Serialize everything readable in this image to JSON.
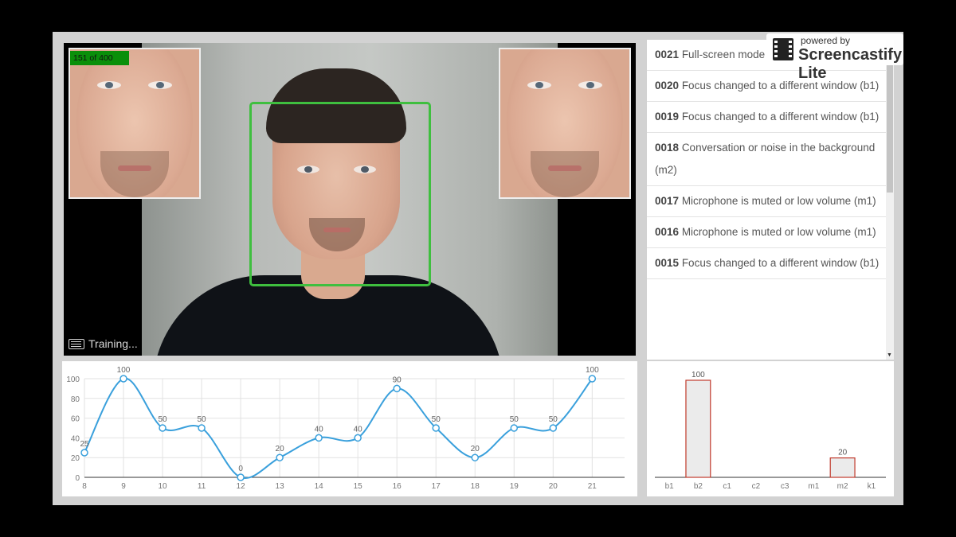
{
  "video": {
    "frame_counter": "151 of 400",
    "status": "Training..."
  },
  "watermark": {
    "line1": "powered by",
    "line2": "Screencastify Lite"
  },
  "event_log": [
    {
      "id": "0021",
      "text": "Full-screen mode"
    },
    {
      "id": "0020",
      "text": "Focus changed to a different window (b1)"
    },
    {
      "id": "0019",
      "text": "Focus changed to a different window (b1)"
    },
    {
      "id": "0018",
      "text": "Conversation or noise in the background (m2)"
    },
    {
      "id": "0017",
      "text": "Microphone is muted or low volume (m1)"
    },
    {
      "id": "0016",
      "text": "Microphone is muted or low volume (m1)"
    },
    {
      "id": "0015",
      "text": "Focus changed to a different window (b1)"
    }
  ],
  "colors": {
    "line": "#3aa0dc",
    "bar_stroke": "#c0392b",
    "face_box": "#3fbf3f"
  },
  "chart_data": [
    {
      "type": "line",
      "x": [
        8,
        9,
        10,
        11,
        12,
        13,
        14,
        15,
        16,
        17,
        18,
        19,
        20,
        21
      ],
      "values": [
        25,
        100,
        50,
        50,
        0,
        20,
        40,
        40,
        90,
        50,
        20,
        50,
        50,
        100
      ],
      "x_ticks": [
        "8",
        "9",
        "10",
        "11",
        "12",
        "13",
        "14",
        "15",
        "16",
        "17",
        "18",
        "19",
        "20",
        "21"
      ],
      "y_ticks": [
        "0",
        "20",
        "40",
        "60",
        "80",
        "100"
      ],
      "ylim": [
        0,
        100
      ],
      "grid": true
    },
    {
      "type": "bar",
      "categories": [
        "b1",
        "b2",
        "c1",
        "c2",
        "c3",
        "m1",
        "m2",
        "k1"
      ],
      "values": [
        0,
        100,
        0,
        0,
        0,
        0,
        20,
        0
      ],
      "ylim": [
        0,
        100
      ]
    }
  ]
}
